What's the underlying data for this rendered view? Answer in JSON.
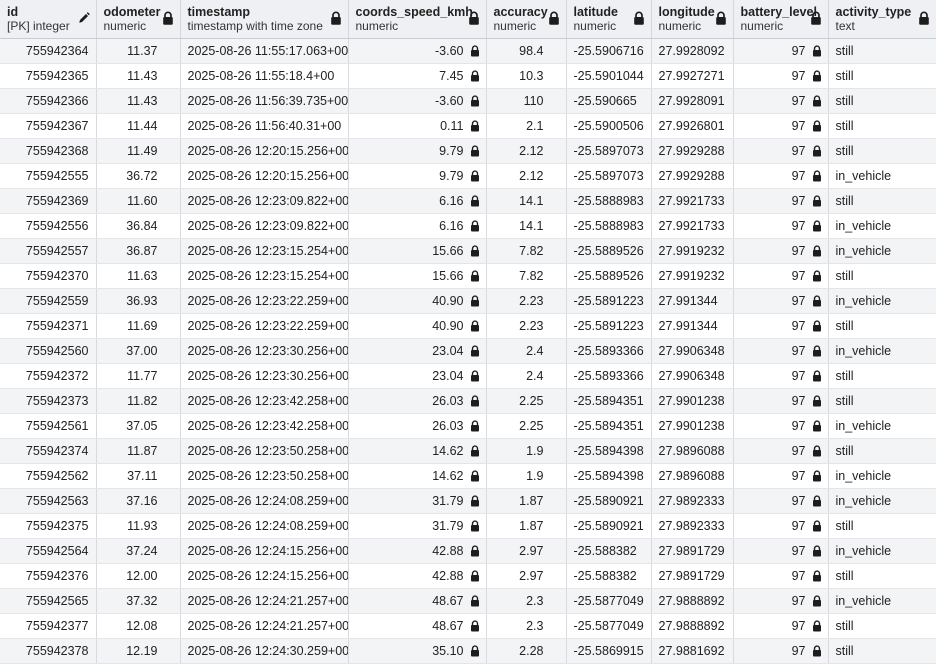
{
  "table": {
    "columns": [
      {
        "name": "id",
        "type": "[PK] integer",
        "icon": "pencil-icon",
        "align": "num"
      },
      {
        "name": "odometer",
        "type": "numeric",
        "icon": "lock-icon",
        "align": "num"
      },
      {
        "name": "timestamp",
        "type": "timestamp with time zone",
        "icon": "lock-icon",
        "align": "txt"
      },
      {
        "name": "coords_speed_kmh",
        "type": "numeric",
        "icon": "lock-icon",
        "align": "num"
      },
      {
        "name": "accuracy",
        "type": "numeric",
        "icon": "lock-icon",
        "align": "num"
      },
      {
        "name": "latitude",
        "type": "numeric",
        "icon": "lock-icon",
        "align": "num"
      },
      {
        "name": "longitude",
        "type": "numeric",
        "icon": "lock-icon",
        "align": "num"
      },
      {
        "name": "battery_level",
        "type": "numeric",
        "icon": "lock-icon",
        "align": "num"
      },
      {
        "name": "activity_type",
        "type": "text",
        "icon": "lock-icon",
        "align": "txt"
      }
    ],
    "rows": [
      [
        "755942364",
        "11.37",
        "2025-08-26 11:55:17.063+00",
        "-3.60",
        "98.4",
        "-25.5906716",
        "27.9928092",
        "97",
        "still"
      ],
      [
        "755942365",
        "11.43",
        "2025-08-26 11:55:18.4+00",
        "7.45",
        "10.3",
        "-25.5901044",
        "27.9927271",
        "97",
        "still"
      ],
      [
        "755942366",
        "11.43",
        "2025-08-26 11:56:39.735+00",
        "-3.60",
        "110",
        "-25.590665",
        "27.9928091",
        "97",
        "still"
      ],
      [
        "755942367",
        "11.44",
        "2025-08-26 11:56:40.31+00",
        "0.11",
        "2.1",
        "-25.5900506",
        "27.9926801",
        "97",
        "still"
      ],
      [
        "755942368",
        "11.49",
        "2025-08-26 12:20:15.256+00",
        "9.79",
        "2.12",
        "-25.5897073",
        "27.9929288",
        "97",
        "still"
      ],
      [
        "755942555",
        "36.72",
        "2025-08-26 12:20:15.256+00",
        "9.79",
        "2.12",
        "-25.5897073",
        "27.9929288",
        "97",
        "in_vehicle"
      ],
      [
        "755942369",
        "11.60",
        "2025-08-26 12:23:09.822+00",
        "6.16",
        "14.1",
        "-25.5888983",
        "27.9921733",
        "97",
        "still"
      ],
      [
        "755942556",
        "36.84",
        "2025-08-26 12:23:09.822+00",
        "6.16",
        "14.1",
        "-25.5888983",
        "27.9921733",
        "97",
        "in_vehicle"
      ],
      [
        "755942557",
        "36.87",
        "2025-08-26 12:23:15.254+00",
        "15.66",
        "7.82",
        "-25.5889526",
        "27.9919232",
        "97",
        "in_vehicle"
      ],
      [
        "755942370",
        "11.63",
        "2025-08-26 12:23:15.254+00",
        "15.66",
        "7.82",
        "-25.5889526",
        "27.9919232",
        "97",
        "still"
      ],
      [
        "755942559",
        "36.93",
        "2025-08-26 12:23:22.259+00",
        "40.90",
        "2.23",
        "-25.5891223",
        "27.991344",
        "97",
        "in_vehicle"
      ],
      [
        "755942371",
        "11.69",
        "2025-08-26 12:23:22.259+00",
        "40.90",
        "2.23",
        "-25.5891223",
        "27.991344",
        "97",
        "still"
      ],
      [
        "755942560",
        "37.00",
        "2025-08-26 12:23:30.256+00",
        "23.04",
        "2.4",
        "-25.5893366",
        "27.9906348",
        "97",
        "in_vehicle"
      ],
      [
        "755942372",
        "11.77",
        "2025-08-26 12:23:30.256+00",
        "23.04",
        "2.4",
        "-25.5893366",
        "27.9906348",
        "97",
        "still"
      ],
      [
        "755942373",
        "11.82",
        "2025-08-26 12:23:42.258+00",
        "26.03",
        "2.25",
        "-25.5894351",
        "27.9901238",
        "97",
        "still"
      ],
      [
        "755942561",
        "37.05",
        "2025-08-26 12:23:42.258+00",
        "26.03",
        "2.25",
        "-25.5894351",
        "27.9901238",
        "97",
        "in_vehicle"
      ],
      [
        "755942374",
        "11.87",
        "2025-08-26 12:23:50.258+00",
        "14.62",
        "1.9",
        "-25.5894398",
        "27.9896088",
        "97",
        "still"
      ],
      [
        "755942562",
        "37.11",
        "2025-08-26 12:23:50.258+00",
        "14.62",
        "1.9",
        "-25.5894398",
        "27.9896088",
        "97",
        "in_vehicle"
      ],
      [
        "755942563",
        "37.16",
        "2025-08-26 12:24:08.259+00",
        "31.79",
        "1.87",
        "-25.5890921",
        "27.9892333",
        "97",
        "in_vehicle"
      ],
      [
        "755942375",
        "11.93",
        "2025-08-26 12:24:08.259+00",
        "31.79",
        "1.87",
        "-25.5890921",
        "27.9892333",
        "97",
        "still"
      ],
      [
        "755942564",
        "37.24",
        "2025-08-26 12:24:15.256+00",
        "42.88",
        "2.97",
        "-25.588382",
        "27.9891729",
        "97",
        "in_vehicle"
      ],
      [
        "755942376",
        "12.00",
        "2025-08-26 12:24:15.256+00",
        "42.88",
        "2.97",
        "-25.588382",
        "27.9891729",
        "97",
        "still"
      ],
      [
        "755942565",
        "37.32",
        "2025-08-26 12:24:21.257+00",
        "48.67",
        "2.3",
        "-25.5877049",
        "27.9888892",
        "97",
        "in_vehicle"
      ],
      [
        "755942377",
        "12.08",
        "2025-08-26 12:24:21.257+00",
        "48.67",
        "2.3",
        "-25.5877049",
        "27.9888892",
        "97",
        "still"
      ],
      [
        "755942378",
        "12.19",
        "2025-08-26 12:24:30.259+00",
        "35.10",
        "2.28",
        "-25.5869915",
        "27.9881692",
        "97",
        "still"
      ]
    ]
  }
}
